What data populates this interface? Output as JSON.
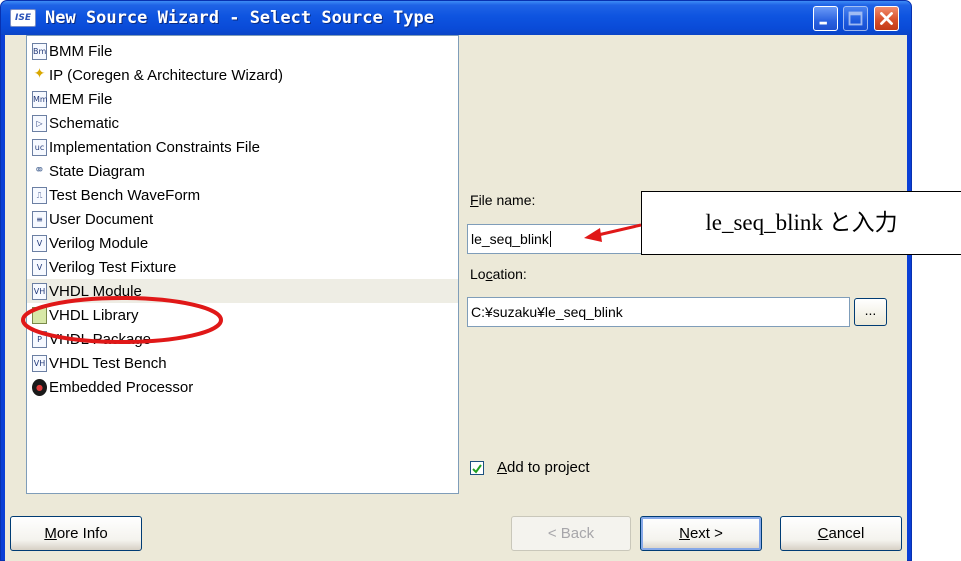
{
  "window": {
    "title": "New Source Wizard - Select Source Type",
    "app_icon_text": "ISE"
  },
  "source_types": [
    {
      "label": "BMM File",
      "icon": "bmm-file-icon",
      "glyph": "Bm"
    },
    {
      "label": "IP (Coregen & Architecture Wizard)",
      "icon": "ip-wizard-icon",
      "glyph": "✦"
    },
    {
      "label": "MEM File",
      "icon": "mem-file-icon",
      "glyph": "Mm"
    },
    {
      "label": "Schematic",
      "icon": "schematic-icon",
      "glyph": "▷"
    },
    {
      "label": "Implementation Constraints File",
      "icon": "constraints-file-icon",
      "glyph": "uc"
    },
    {
      "label": "State Diagram",
      "icon": "state-diagram-icon",
      "glyph": "⚭"
    },
    {
      "label": "Test Bench WaveForm",
      "icon": "waveform-icon",
      "glyph": "⎍"
    },
    {
      "label": "User Document",
      "icon": "document-icon",
      "glyph": "≡"
    },
    {
      "label": "Verilog Module",
      "icon": "verilog-module-icon",
      "glyph": "V"
    },
    {
      "label": "Verilog Test Fixture",
      "icon": "verilog-fixture-icon",
      "glyph": "V"
    },
    {
      "label": "VHDL Module",
      "icon": "vhdl-module-icon",
      "glyph": "VH",
      "selected": true
    },
    {
      "label": "VHDL Library",
      "icon": "vhdl-library-icon",
      "glyph": ""
    },
    {
      "label": "VHDL Package",
      "icon": "vhdl-package-icon",
      "glyph": "P"
    },
    {
      "label": "VHDL Test Bench",
      "icon": "vhdl-testbench-icon",
      "glyph": "VH"
    },
    {
      "label": "Embedded Processor",
      "icon": "processor-icon",
      "glyph": "●"
    }
  ],
  "form": {
    "file_name_label_prefix": "",
    "file_name_label_accel": "F",
    "file_name_label_rest": "ile name:",
    "file_name_value": "le_seq_blink",
    "location_label_prefix": "Lo",
    "location_label_accel": "c",
    "location_label_rest": "ation:",
    "location_value": "C:¥suzaku¥le_seq_blink",
    "browse_label": "...",
    "add_to_project_accel": "A",
    "add_to_project_rest": "dd to project",
    "add_to_project_checked": true
  },
  "buttons": {
    "more_info_accel": "M",
    "more_info_rest": "ore Info",
    "back": "< Back",
    "back_accel": "B",
    "next_accel": "N",
    "next_rest": "ext >",
    "cancel_accel": "C",
    "cancel_rest": "ancel"
  },
  "annotation": {
    "callout_text": "le_seq_blink と入力",
    "arrow_color": "#e01818",
    "ellipse_color": "#e01818"
  }
}
